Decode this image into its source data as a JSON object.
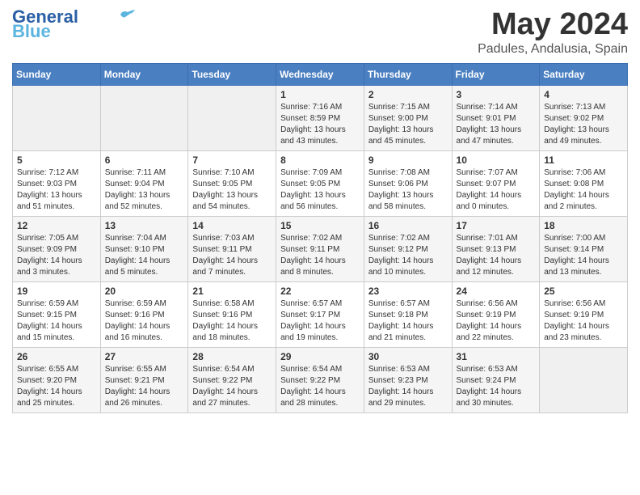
{
  "logo": {
    "line1": "General",
    "line2": "Blue"
  },
  "title": "May 2024",
  "location": "Padules, Andalusia, Spain",
  "days_of_week": [
    "Sunday",
    "Monday",
    "Tuesday",
    "Wednesday",
    "Thursday",
    "Friday",
    "Saturday"
  ],
  "weeks": [
    [
      {
        "day": "",
        "info": ""
      },
      {
        "day": "",
        "info": ""
      },
      {
        "day": "",
        "info": ""
      },
      {
        "day": "1",
        "info": "Sunrise: 7:16 AM\nSunset: 8:59 PM\nDaylight: 13 hours\nand 43 minutes."
      },
      {
        "day": "2",
        "info": "Sunrise: 7:15 AM\nSunset: 9:00 PM\nDaylight: 13 hours\nand 45 minutes."
      },
      {
        "day": "3",
        "info": "Sunrise: 7:14 AM\nSunset: 9:01 PM\nDaylight: 13 hours\nand 47 minutes."
      },
      {
        "day": "4",
        "info": "Sunrise: 7:13 AM\nSunset: 9:02 PM\nDaylight: 13 hours\nand 49 minutes."
      }
    ],
    [
      {
        "day": "5",
        "info": "Sunrise: 7:12 AM\nSunset: 9:03 PM\nDaylight: 13 hours\nand 51 minutes."
      },
      {
        "day": "6",
        "info": "Sunrise: 7:11 AM\nSunset: 9:04 PM\nDaylight: 13 hours\nand 52 minutes."
      },
      {
        "day": "7",
        "info": "Sunrise: 7:10 AM\nSunset: 9:05 PM\nDaylight: 13 hours\nand 54 minutes."
      },
      {
        "day": "8",
        "info": "Sunrise: 7:09 AM\nSunset: 9:05 PM\nDaylight: 13 hours\nand 56 minutes."
      },
      {
        "day": "9",
        "info": "Sunrise: 7:08 AM\nSunset: 9:06 PM\nDaylight: 13 hours\nand 58 minutes."
      },
      {
        "day": "10",
        "info": "Sunrise: 7:07 AM\nSunset: 9:07 PM\nDaylight: 14 hours\nand 0 minutes."
      },
      {
        "day": "11",
        "info": "Sunrise: 7:06 AM\nSunset: 9:08 PM\nDaylight: 14 hours\nand 2 minutes."
      }
    ],
    [
      {
        "day": "12",
        "info": "Sunrise: 7:05 AM\nSunset: 9:09 PM\nDaylight: 14 hours\nand 3 minutes."
      },
      {
        "day": "13",
        "info": "Sunrise: 7:04 AM\nSunset: 9:10 PM\nDaylight: 14 hours\nand 5 minutes."
      },
      {
        "day": "14",
        "info": "Sunrise: 7:03 AM\nSunset: 9:11 PM\nDaylight: 14 hours\nand 7 minutes."
      },
      {
        "day": "15",
        "info": "Sunrise: 7:02 AM\nSunset: 9:11 PM\nDaylight: 14 hours\nand 8 minutes."
      },
      {
        "day": "16",
        "info": "Sunrise: 7:02 AM\nSunset: 9:12 PM\nDaylight: 14 hours\nand 10 minutes."
      },
      {
        "day": "17",
        "info": "Sunrise: 7:01 AM\nSunset: 9:13 PM\nDaylight: 14 hours\nand 12 minutes."
      },
      {
        "day": "18",
        "info": "Sunrise: 7:00 AM\nSunset: 9:14 PM\nDaylight: 14 hours\nand 13 minutes."
      }
    ],
    [
      {
        "day": "19",
        "info": "Sunrise: 6:59 AM\nSunset: 9:15 PM\nDaylight: 14 hours\nand 15 minutes."
      },
      {
        "day": "20",
        "info": "Sunrise: 6:59 AM\nSunset: 9:16 PM\nDaylight: 14 hours\nand 16 minutes."
      },
      {
        "day": "21",
        "info": "Sunrise: 6:58 AM\nSunset: 9:16 PM\nDaylight: 14 hours\nand 18 minutes."
      },
      {
        "day": "22",
        "info": "Sunrise: 6:57 AM\nSunset: 9:17 PM\nDaylight: 14 hours\nand 19 minutes."
      },
      {
        "day": "23",
        "info": "Sunrise: 6:57 AM\nSunset: 9:18 PM\nDaylight: 14 hours\nand 21 minutes."
      },
      {
        "day": "24",
        "info": "Sunrise: 6:56 AM\nSunset: 9:19 PM\nDaylight: 14 hours\nand 22 minutes."
      },
      {
        "day": "25",
        "info": "Sunrise: 6:56 AM\nSunset: 9:19 PM\nDaylight: 14 hours\nand 23 minutes."
      }
    ],
    [
      {
        "day": "26",
        "info": "Sunrise: 6:55 AM\nSunset: 9:20 PM\nDaylight: 14 hours\nand 25 minutes."
      },
      {
        "day": "27",
        "info": "Sunrise: 6:55 AM\nSunset: 9:21 PM\nDaylight: 14 hours\nand 26 minutes."
      },
      {
        "day": "28",
        "info": "Sunrise: 6:54 AM\nSunset: 9:22 PM\nDaylight: 14 hours\nand 27 minutes."
      },
      {
        "day": "29",
        "info": "Sunrise: 6:54 AM\nSunset: 9:22 PM\nDaylight: 14 hours\nand 28 minutes."
      },
      {
        "day": "30",
        "info": "Sunrise: 6:53 AM\nSunset: 9:23 PM\nDaylight: 14 hours\nand 29 minutes."
      },
      {
        "day": "31",
        "info": "Sunrise: 6:53 AM\nSunset: 9:24 PM\nDaylight: 14 hours\nand 30 minutes."
      },
      {
        "day": "",
        "info": ""
      }
    ]
  ]
}
